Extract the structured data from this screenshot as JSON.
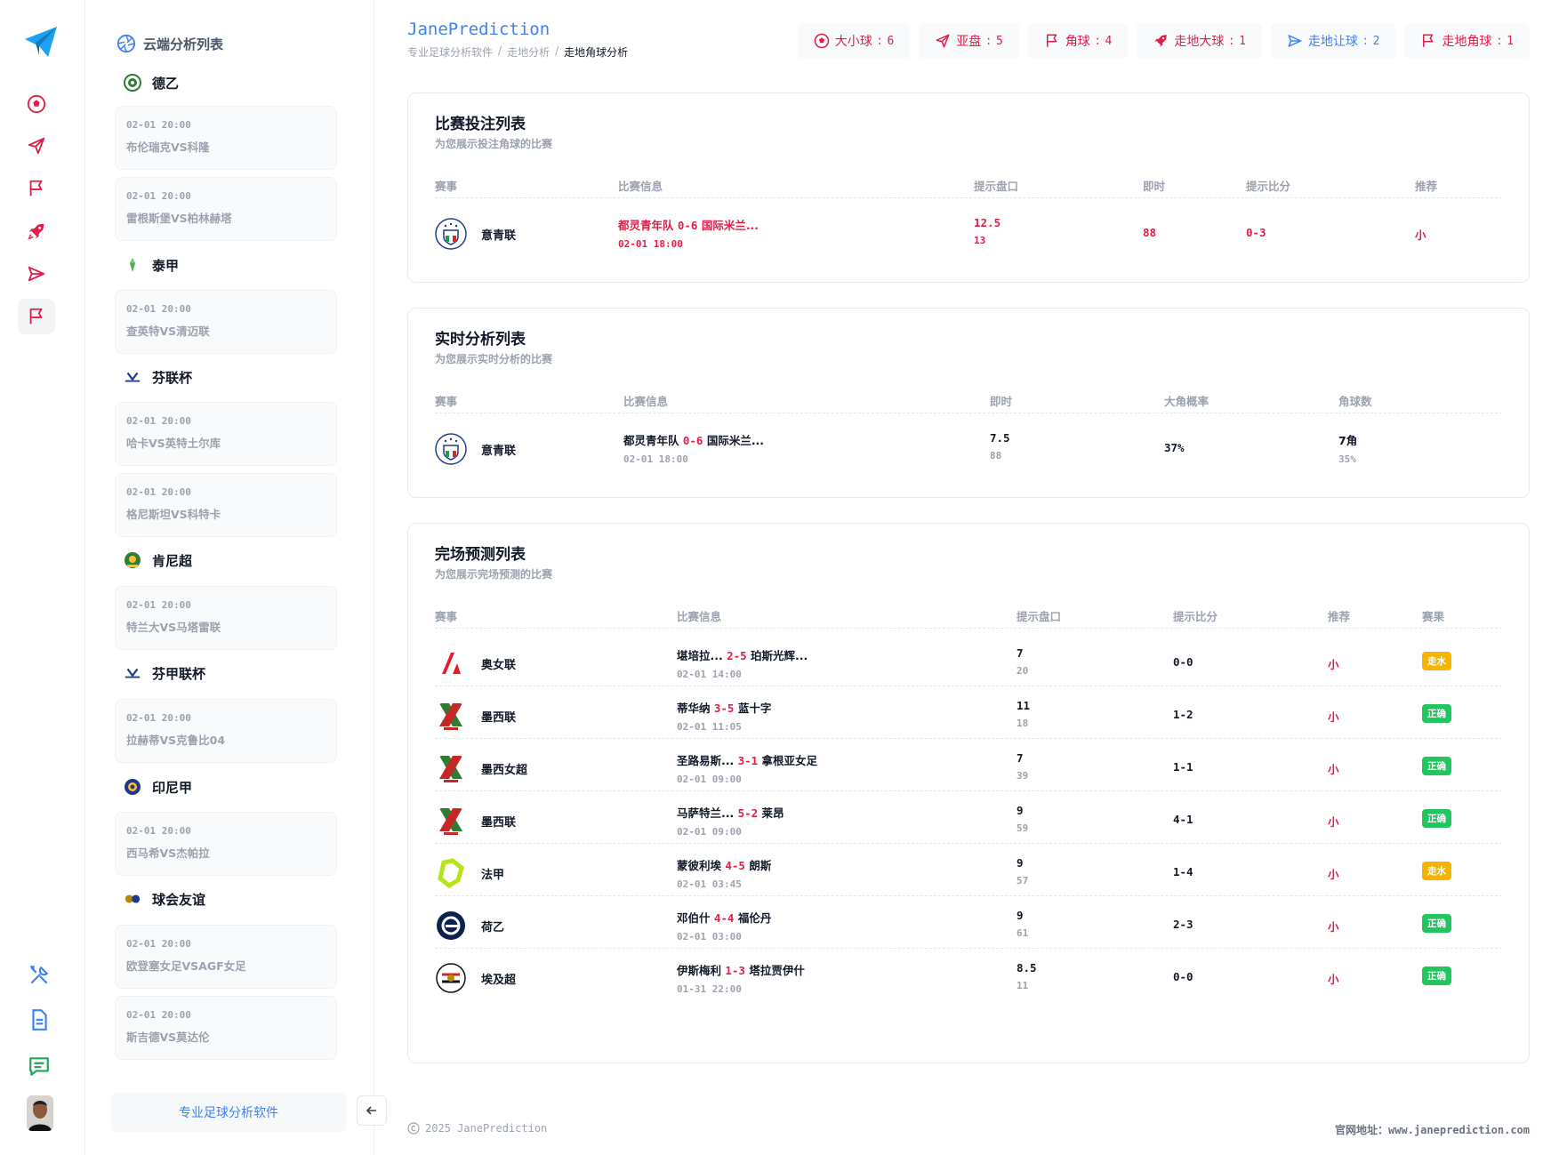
{
  "app": {
    "brand": "JanePrediction"
  },
  "breadcrumb": [
    "专业足球分析软件",
    "走地分析",
    "走地角球分析"
  ],
  "stats": [
    {
      "label": "大小球",
      "count": "6",
      "color": "#e11d48",
      "icon": "soccer-ball-icon"
    },
    {
      "label": "亚盘",
      "count": "5",
      "color": "#e11d48",
      "icon": "paper-plane-icon"
    },
    {
      "label": "角球",
      "count": "4",
      "color": "#e11d48",
      "icon": "flag-icon"
    },
    {
      "label": "走地大球",
      "count": "1",
      "color": "#e11d48",
      "icon": "rocket-icon"
    },
    {
      "label": "走地让球",
      "count": "2",
      "color": "#3b82f6",
      "icon": "send-icon"
    },
    {
      "label": "走地角球",
      "count": "1",
      "color": "#e11d48",
      "icon": "flag-icon"
    }
  ],
  "sidebar": {
    "title": "云端分析列表",
    "leagues": [
      {
        "name": "德乙",
        "matches": [
          {
            "time": "02-01 20:00",
            "teams": "布伦瑞克VS科隆"
          },
          {
            "time": "02-01 20:00",
            "teams": "雷根斯堡VS柏林赫塔"
          }
        ]
      },
      {
        "name": "泰甲",
        "matches": [
          {
            "time": "02-01 20:00",
            "teams": "查英特VS清迈联"
          }
        ]
      },
      {
        "name": "芬联杯",
        "matches": [
          {
            "time": "02-01 20:00",
            "teams": "哈卡VS英特土尔库"
          },
          {
            "time": "02-01 20:00",
            "teams": "格尼斯坦VS科特卡"
          }
        ]
      },
      {
        "name": "肯尼超",
        "matches": [
          {
            "time": "02-01 20:00",
            "teams": "特兰大VS马塔雷联"
          }
        ]
      },
      {
        "name": "芬甲联杯",
        "matches": [
          {
            "time": "02-01 20:00",
            "teams": "拉赫蒂VS克鲁比04"
          }
        ]
      },
      {
        "name": "印尼甲",
        "matches": [
          {
            "time": "02-01 20:00",
            "teams": "西马希VS杰帕拉"
          }
        ]
      },
      {
        "name": "球会友谊",
        "matches": [
          {
            "time": "02-01 20:00",
            "teams": "欧登塞女足VSAGF女足"
          },
          {
            "time": "02-01 20:00",
            "teams": "斯吉德VS莫达伦"
          }
        ]
      }
    ],
    "footer": "专业足球分析软件"
  },
  "bet_list": {
    "title": "比赛投注列表",
    "subtitle": "为您展示投注角球的比赛",
    "headers": [
      "赛事",
      "比赛信息",
      "提示盘口",
      "即时",
      "提示比分",
      "推荐"
    ],
    "rows": [
      {
        "league": "意青联",
        "home": "都灵青年队",
        "score": "0-6",
        "away": "国际米兰...",
        "time": "02-01 18:00",
        "line": "12.5",
        "line_sub": "13",
        "live": "88",
        "tip_score": "0-3",
        "rec": "小"
      }
    ]
  },
  "live_list": {
    "title": "实时分析列表",
    "subtitle": "为您展示实时分析的比赛",
    "headers": [
      "赛事",
      "比赛信息",
      "即时",
      "大角概率",
      "角球数"
    ],
    "rows": [
      {
        "league": "意青联",
        "home": "都灵青年队",
        "score": "0-6",
        "away": "国际米兰...",
        "time": "02-01 18:00",
        "live": "7.5",
        "live_sub": "88",
        "prob": "37%",
        "corners": "7角",
        "corners_sub": "35%"
      }
    ]
  },
  "full_list": {
    "title": "完场预测列表",
    "subtitle": "为您展示完场预测的比赛",
    "headers": [
      "赛事",
      "比赛信息",
      "提示盘口",
      "提示比分",
      "推荐",
      "赛果"
    ],
    "rows": [
      {
        "league": "奥女联",
        "home": "堪培拉...",
        "score": "2-5",
        "away": "珀斯光辉...",
        "time": "02-01 14:00",
        "line": "7",
        "line_sub": "20",
        "tip_score": "0-0",
        "rec": "小",
        "result": "走水",
        "result_color": "#f5b400"
      },
      {
        "league": "墨西联",
        "home": "蒂华纳",
        "score": "3-5",
        "away": "蓝十字",
        "time": "02-01 11:05",
        "line": "11",
        "line_sub": "18",
        "tip_score": "1-2",
        "rec": "小",
        "result": "正确",
        "result_color": "#22c55e"
      },
      {
        "league": "墨西女超",
        "home": "圣路易斯...",
        "score": "3-1",
        "away": "拿根亚女足",
        "time": "02-01 09:00",
        "line": "7",
        "line_sub": "39",
        "tip_score": "1-1",
        "rec": "小",
        "result": "正确",
        "result_color": "#22c55e"
      },
      {
        "league": "墨西联",
        "home": "马萨特兰...",
        "score": "5-2",
        "away": "莱昂",
        "time": "02-01 09:00",
        "line": "9",
        "line_sub": "59",
        "tip_score": "4-1",
        "rec": "小",
        "result": "正确",
        "result_color": "#22c55e"
      },
      {
        "league": "法甲",
        "home": "蒙彼利埃",
        "score": "4-5",
        "away": "朗斯",
        "time": "02-01 03:45",
        "line": "9",
        "line_sub": "57",
        "tip_score": "1-4",
        "rec": "小",
        "result": "走水",
        "result_color": "#f5b400"
      },
      {
        "league": "荷乙",
        "home": "邓伯什",
        "score": "4-4",
        "away": "福伦丹",
        "time": "02-01 03:00",
        "line": "9",
        "line_sub": "61",
        "tip_score": "2-3",
        "rec": "小",
        "result": "正确",
        "result_color": "#22c55e"
      },
      {
        "league": "埃及超",
        "home": "伊斯梅利",
        "score": "1-3",
        "away": "塔拉贾伊什",
        "time": "01-31 22:00",
        "line": "8.5",
        "line_sub": "11",
        "tip_score": "0-0",
        "rec": "小",
        "result": "正确",
        "result_color": "#22c55e"
      }
    ]
  },
  "footer": {
    "copyright": "2025 JanePrediction",
    "site_label": "官网地址：",
    "site_url": "www.janeprediction.com"
  }
}
